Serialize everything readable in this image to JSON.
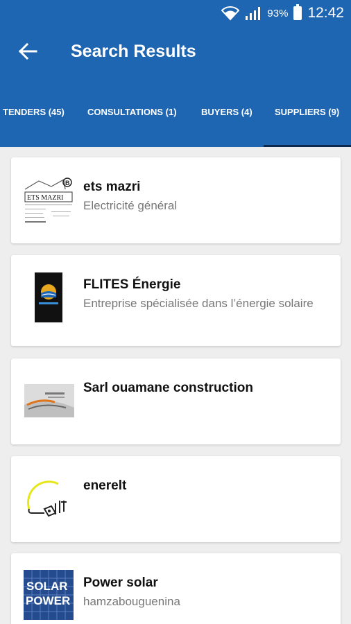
{
  "status": {
    "battery_percent": "93%",
    "time": "12:42",
    "icons": [
      "wifi-icon",
      "signal-icon",
      "battery-icon"
    ]
  },
  "header": {
    "title": "Search Results",
    "back_icon": "back-arrow-icon",
    "background_color": "#1f66b2"
  },
  "tabs": [
    {
      "label": "TENDERS (45)",
      "selected": false
    },
    {
      "label": "CONSULTATIONS (1)",
      "selected": false
    },
    {
      "label": "BUYERS (4)",
      "selected": false
    },
    {
      "label": "SUPPLIERS (9)",
      "selected": true
    }
  ],
  "results": [
    {
      "name": "ets mazri",
      "description": "Electricité général",
      "logo": "ets-mazri-logo",
      "logo_text": "ETS MAZRI"
    },
    {
      "name": "FLITES Énergie",
      "description": "Entreprise spécialisée dans l’énergie solaire",
      "logo": "flites-energie-logo"
    },
    {
      "name": "Sarl ouamane construction",
      "description": "",
      "logo": "ouamane-business-card-logo"
    },
    {
      "name": "enerelt",
      "description": "",
      "logo": "enerelt-bulb-logo"
    },
    {
      "name": "Power solar",
      "description": "hamzabouguenina",
      "logo": "solar-power-logo",
      "logo_text": [
        "SOLAR",
        "POWER"
      ]
    }
  ]
}
